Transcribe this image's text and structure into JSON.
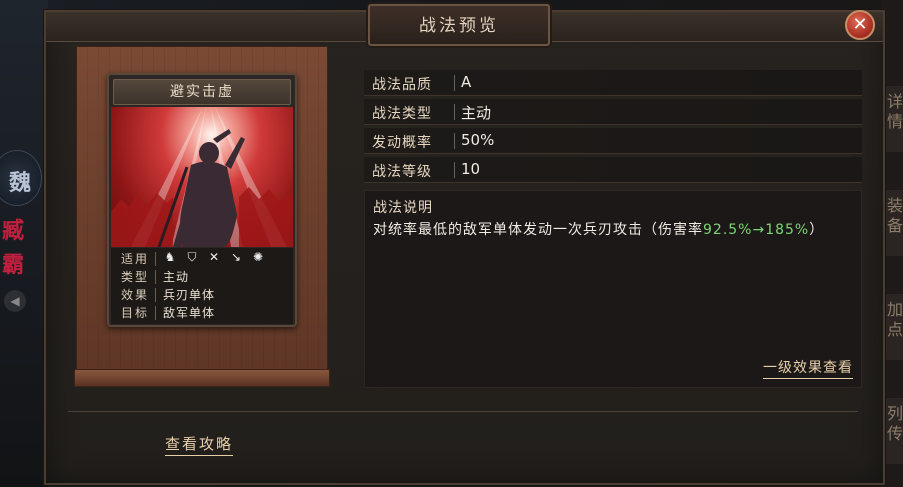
{
  "dialog": {
    "title": "战法预览",
    "close_label": "✕"
  },
  "background": {
    "badge_text": "魏",
    "left_name": "臧霸",
    "right_tabs": [
      "详情",
      "装备",
      "加点",
      "列传"
    ]
  },
  "card": {
    "name": "避实击虚",
    "rows": [
      {
        "key": "适用",
        "value": ""
      },
      {
        "key": "类型",
        "value": "主动"
      },
      {
        "key": "效果",
        "value": "兵刃单体"
      },
      {
        "key": "目标",
        "value": "敌军单体"
      }
    ],
    "applicable_icons": [
      "cavalry-icon",
      "shield-icon",
      "archer-icon",
      "spear-icon",
      "siege-icon"
    ]
  },
  "properties": [
    {
      "key": "战法品质",
      "value": "A"
    },
    {
      "key": "战法类型",
      "value": "主动"
    },
    {
      "key": "发动概率",
      "value": "50%"
    },
    {
      "key": "战法等级",
      "value": "10"
    }
  ],
  "description": {
    "title": "战法说明",
    "text_before": "对统率最低的敌军单体发动一次兵刃攻击（伤害率",
    "highlight": "92.5%→185%",
    "text_after": "）"
  },
  "links": {
    "level_one": "一级效果查看",
    "guide": "查看攻略"
  },
  "colors": {
    "highlight_green": "#7ed474",
    "link_gold": "#e7cfa8",
    "close_red": "#a22a1f"
  }
}
